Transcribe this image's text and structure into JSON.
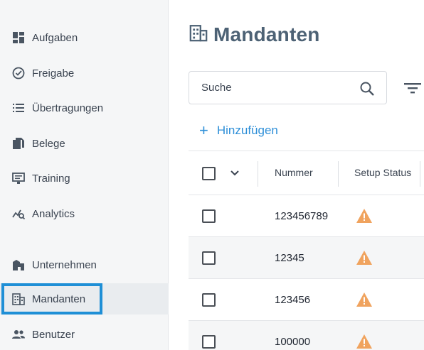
{
  "sidebar": {
    "items": [
      {
        "label": "Aufgaben",
        "icon": "dashboard-icon"
      },
      {
        "label": "Freigabe",
        "icon": "check-circle-icon"
      },
      {
        "label": "Übertragungen",
        "icon": "list-icon"
      },
      {
        "label": "Belege",
        "icon": "documents-icon"
      },
      {
        "label": "Training",
        "icon": "training-icon"
      },
      {
        "label": "Analytics",
        "icon": "analytics-icon"
      },
      {
        "label": "Unternehmen",
        "icon": "company-icon"
      },
      {
        "label": "Mandanten",
        "icon": "building-icon",
        "active": true
      },
      {
        "label": "Benutzer",
        "icon": "users-icon"
      }
    ]
  },
  "main": {
    "title": "Mandanten",
    "search": {
      "placeholder": "Suche"
    },
    "add_label": "Hinzufügen",
    "table": {
      "columns": [
        "Nummer",
        "Setup Status"
      ],
      "rows": [
        {
          "number": "123456789",
          "status": "warning"
        },
        {
          "number": "12345",
          "status": "warning"
        },
        {
          "number": "123456",
          "status": "warning"
        },
        {
          "number": "100000",
          "status": "warning"
        }
      ]
    }
  },
  "colors": {
    "accent": "#2e8fd8",
    "focus": "#1f8fd6",
    "title": "#4d6275",
    "warning": "#f0a35e",
    "sidebar_bg": "#f5f6f7"
  }
}
